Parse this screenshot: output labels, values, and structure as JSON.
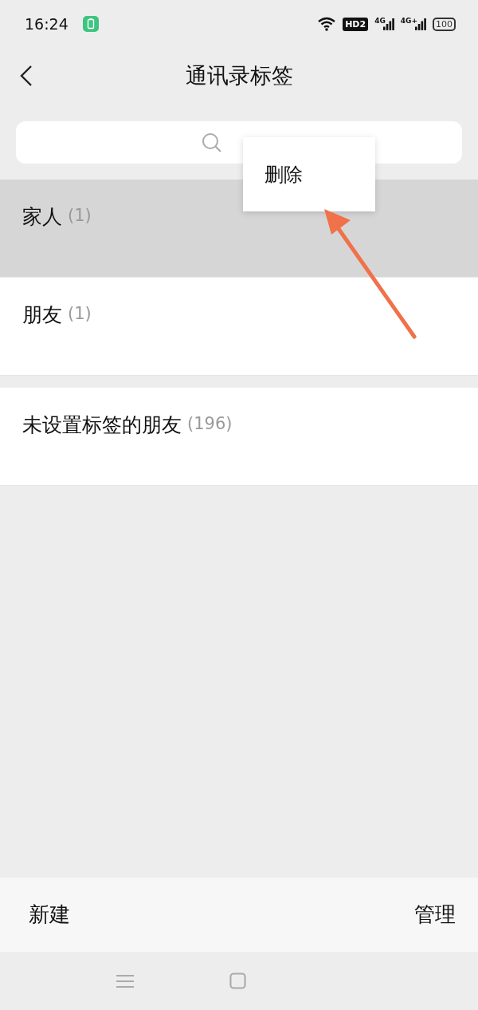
{
  "status_bar": {
    "time": "16:24",
    "hd_badge": "HD2",
    "signals": [
      {
        "label": "4G"
      },
      {
        "label": "4G+"
      }
    ],
    "battery": "100"
  },
  "header": {
    "title": "通讯录标签"
  },
  "sections": [
    {
      "rows": [
        {
          "name": "家人",
          "count": "(1)",
          "selected": true
        },
        {
          "name": "朋友",
          "count": "(1)",
          "selected": false
        }
      ]
    },
    {
      "rows": [
        {
          "name": "未设置标签的朋友",
          "count": "(196)",
          "selected": false
        }
      ]
    }
  ],
  "context_menu": {
    "items": [
      "删除"
    ]
  },
  "bottom_bar": {
    "left": "新建",
    "right": "管理"
  }
}
